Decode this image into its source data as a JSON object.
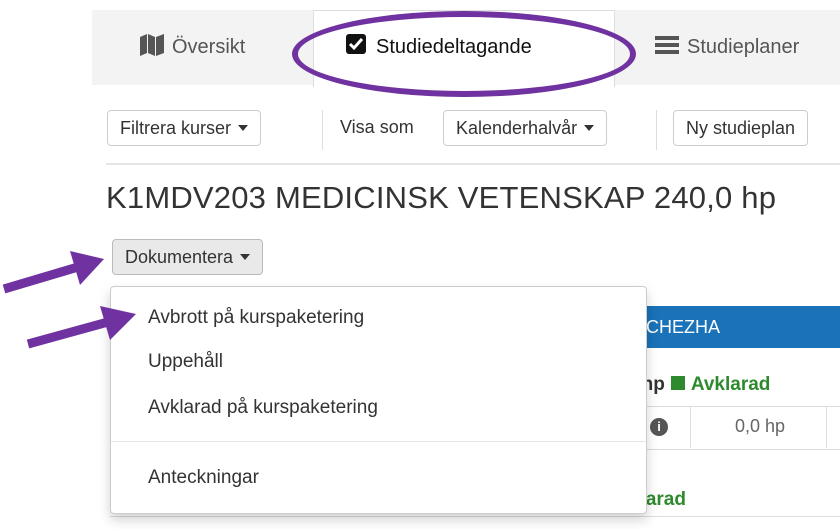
{
  "tabs": [
    {
      "label": "Översikt",
      "icon": "map-icon"
    },
    {
      "label": "Studiedeltagande",
      "icon": "checkbox-checked-icon",
      "active": true
    },
    {
      "label": "Studieplaner",
      "icon": "list-icon"
    }
  ],
  "toolbar": {
    "filter_label": "Filtrera kurser",
    "view_as_label": "Visa som",
    "view_as_value": "Kalenderhalvår",
    "new_plan_label": "Ny studieplan"
  },
  "heading": "K1MDV203 MEDICINSK VETENSKAP 240,0 hp",
  "document_button": "Dokumentera",
  "menu": {
    "items": [
      "Avbrott på kurspaketering",
      "Uppehåll",
      "Avklarad på kurspaketering"
    ],
    "notes": "Anteckningar"
  },
  "background": {
    "blue_bar_text": "1CHEZHA",
    "status1_prefix": ") hp",
    "status1": "Avklarad",
    "cell_value": "0,0 hp",
    "status2": "klarad"
  },
  "colors": {
    "annotation": "#7032a0",
    "primary": "#1a72b8",
    "success": "#2d8a2d"
  }
}
